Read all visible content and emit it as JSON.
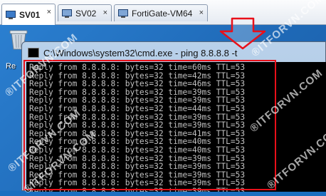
{
  "tabs": [
    {
      "label": "SV01",
      "close": "×",
      "active": true
    },
    {
      "label": "SV02",
      "close": "×",
      "active": false
    },
    {
      "label": "FortiGate-VM64",
      "close": "×",
      "active": false
    }
  ],
  "desktop": {
    "recycle_label": "Re"
  },
  "window": {
    "title": "C:\\Windows\\system32\\cmd.exe - ping  8.8.8.8 -t"
  },
  "console": {
    "lines": [
      "Reply from 8.8.8.8: bytes=32 time=60ms TTL=53",
      "Reply from 8.8.8.8: bytes=32 time=42ms TTL=53",
      "Reply from 8.8.8.8: bytes=32 time=46ms TTL=53",
      "Reply from 8.8.8.8: bytes=32 time=39ms TTL=53",
      "Reply from 8.8.8.8: bytes=32 time=39ms TTL=53",
      "Reply from 8.8.8.8: bytes=32 time=44ms TTL=53",
      "Reply from 8.8.8.8: bytes=32 time=39ms TTL=53",
      "Reply from 8.8.8.8: bytes=32 time=39ms TTL=53",
      "Reply from 8.8.8.8: bytes=32 time=41ms TTL=53",
      "Reply from 8.8.8.8: bytes=32 time=40ms TTL=53",
      "Reply from 8.8.8.8: bytes=32 time=40ms TTL=53",
      "Reply from 8.8.8.8: bytes=32 time=39ms TTL=53",
      "Reply from 8.8.8.8: bytes=32 time=39ms TTL=53",
      "Reply from 8.8.8.8: bytes=32 time=39ms TTL=53",
      "Reply from 8.8.8.8: bytes=32 time=39ms TTL=53",
      "Reply from 8.8.8.8: bytes=32 time=39ms TTL=53"
    ]
  },
  "watermarks": [
    "®ITFORVN.COM",
    "®ITFORVN.COM",
    "®ITFORVN.COM",
    "®ITFORVN.COM",
    "®ITFORVN.COM",
    "®ITFORVN.COM"
  ],
  "colors": {
    "highlight": "#e8101a",
    "console_bg": "#000000",
    "console_text": "#c0c0c0",
    "desktop": "#1f6ab8"
  }
}
